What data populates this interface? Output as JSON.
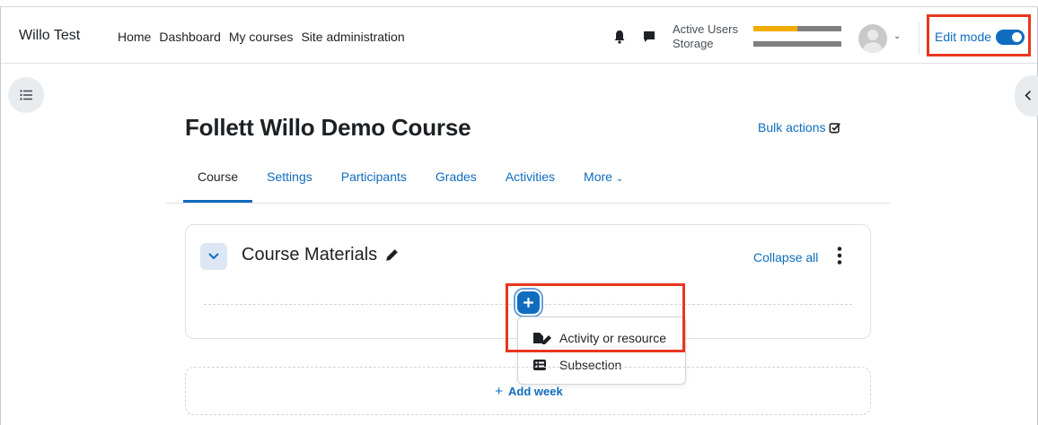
{
  "navbar": {
    "brand": "Willo Test",
    "links": [
      "Home",
      "Dashboard",
      "My courses",
      "Site administration"
    ],
    "quota": {
      "active_users_label": "Active Users",
      "storage_label": "Storage",
      "active_users_fraction": 0.5,
      "storage_fraction": 0.0
    },
    "edit_mode_label": "Edit mode",
    "edit_mode_on": true,
    "icons": [
      "bell-icon",
      "chat-icon",
      "chevron-down-icon",
      "toggle-on-icon"
    ]
  },
  "course": {
    "title": "Follett Willo Demo Course",
    "bulk_actions": "Bulk actions"
  },
  "tabs": [
    "Course",
    "Settings",
    "Participants",
    "Grades",
    "Activities",
    "More"
  ],
  "section": {
    "title": "Course Materials",
    "collapse_all": "Collapse all"
  },
  "add_menu": {
    "items": [
      "Activity or resource",
      "Subsection"
    ]
  },
  "add_week": "Add week",
  "colors": {
    "accent": "#0f6cbf",
    "highlight": "#e8371d",
    "quota_used": "#f5ac00",
    "quota_bar": "#7f7f7f"
  }
}
